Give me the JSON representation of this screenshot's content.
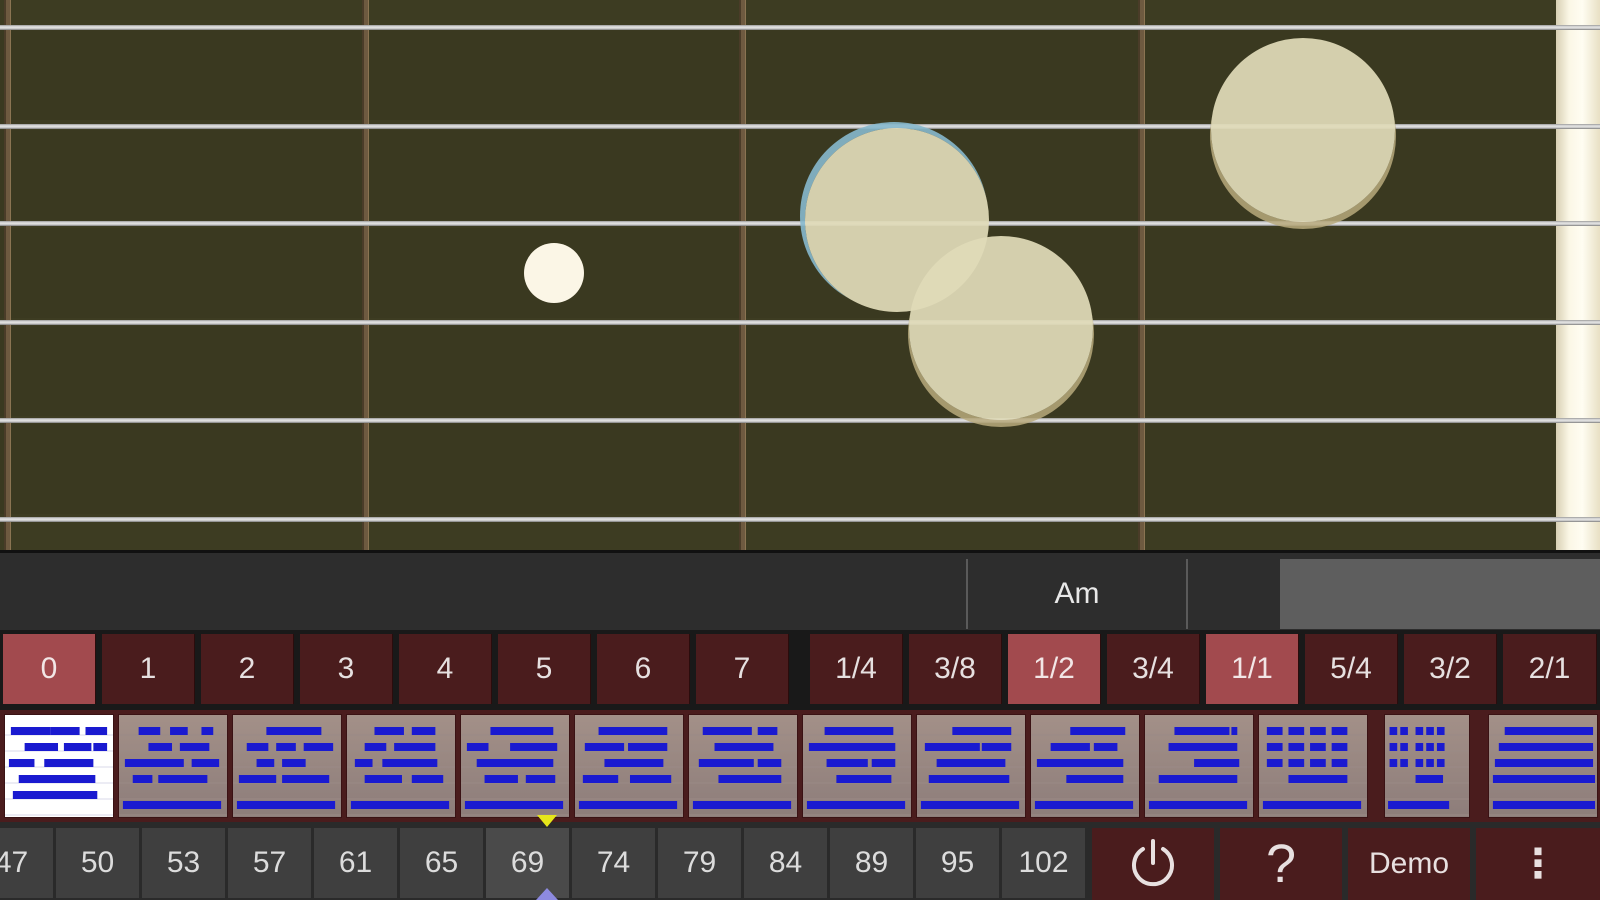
{
  "fretboard": {
    "strings": 6,
    "fret_markers": [
      "single-dot"
    ],
    "finger_positions": [
      "touch-1",
      "touch-2",
      "touch-3"
    ]
  },
  "chord_bar": {
    "current_chord": "Am"
  },
  "numbers": {
    "items": [
      {
        "label": "0",
        "selected": true
      },
      {
        "label": "1",
        "selected": false
      },
      {
        "label": "2",
        "selected": false
      },
      {
        "label": "3",
        "selected": false
      },
      {
        "label": "4",
        "selected": false
      },
      {
        "label": "5",
        "selected": false
      },
      {
        "label": "6",
        "selected": false
      },
      {
        "label": "7",
        "selected": false
      }
    ]
  },
  "durations": {
    "items": [
      {
        "label": "1/4",
        "selected": false
      },
      {
        "label": "3/8",
        "selected": false
      },
      {
        "label": "1/2",
        "selected": true
      },
      {
        "label": "3/4",
        "selected": false
      },
      {
        "label": "1/1",
        "selected": true
      },
      {
        "label": "5/4",
        "selected": false
      },
      {
        "label": "3/2",
        "selected": false
      },
      {
        "label": "2/1",
        "selected": false
      }
    ]
  },
  "patterns": {
    "count": 14,
    "selected_index": 0,
    "pattern_color": "#1a1ad0"
  },
  "tempo": {
    "items": [
      "47",
      "50",
      "53",
      "57",
      "61",
      "65",
      "69",
      "74",
      "79",
      "84",
      "89",
      "95",
      "102"
    ],
    "selected": "69",
    "marker_color_top": "#e6e61a",
    "marker_color_bottom": "#8d8ae0"
  },
  "controls": {
    "power_icon": "power-icon",
    "help_glyph": "?",
    "demo_label": "Demo",
    "menu_glyph": "⋮"
  },
  "colors": {
    "fretboard": "#3d3c22",
    "button_dark_red": "#4a1c1d",
    "button_selected": "#a24a4e",
    "string": "#cfcfcf"
  }
}
